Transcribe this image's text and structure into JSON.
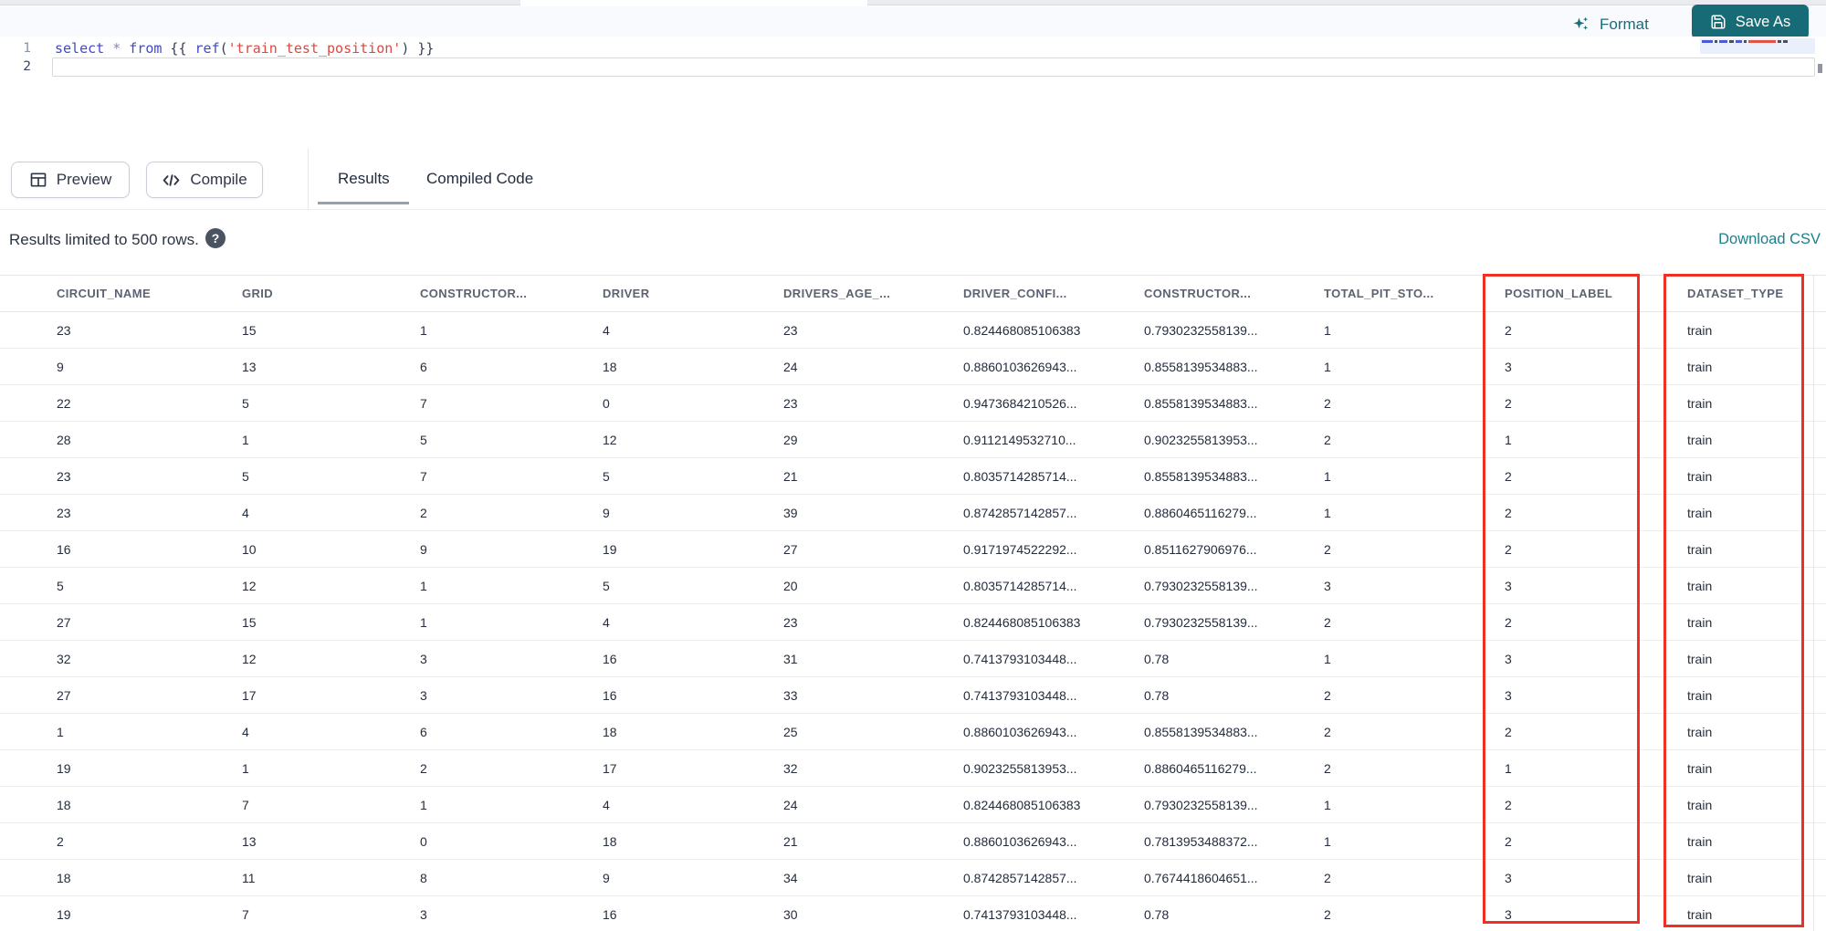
{
  "colors": {
    "accent_teal": "#176b77",
    "link_teal": "#1b7f8e",
    "highlight_red": "#ee3124",
    "keyword_blue": "#3f48c8",
    "string_red": "#de4840"
  },
  "top": {
    "format_label": "Format",
    "save_as_label": "Save As"
  },
  "editor": {
    "lines": [
      {
        "number": "1",
        "tokens": [
          {
            "t": "select",
            "c": "kw"
          },
          {
            "t": " ",
            "c": "br"
          },
          {
            "t": "*",
            "c": "op"
          },
          {
            "t": " ",
            "c": "br"
          },
          {
            "t": "from",
            "c": "kw"
          },
          {
            "t": " {{ ",
            "c": "br"
          },
          {
            "t": "ref",
            "c": "kw"
          },
          {
            "t": "(",
            "c": "br"
          },
          {
            "t": "'train_test_position'",
            "c": "str"
          },
          {
            "t": ") }}",
            "c": "br"
          }
        ]
      },
      {
        "number": "2",
        "tokens": []
      }
    ]
  },
  "toolbar": {
    "preview_label": "Preview",
    "compile_label": "Compile",
    "tabs": [
      {
        "label": "Results",
        "active": true
      },
      {
        "label": "Compiled Code",
        "active": false
      }
    ]
  },
  "results": {
    "limit_note": "Results limited to 500 rows.",
    "help_icon_glyph": "?",
    "download_label": "Download CSV"
  },
  "table": {
    "columns": [
      "CIRCUIT_NAME",
      "GRID",
      "CONSTRUCTOR...",
      "DRIVER",
      "DRIVERS_AGE_...",
      "DRIVER_CONFI...",
      "CONSTRUCTOR...",
      "TOTAL_PIT_STO...",
      "POSITION_LABEL",
      "DATASET_TYPE"
    ],
    "highlighted_columns": [
      "POSITION_LABEL",
      "DATASET_TYPE"
    ],
    "rows": [
      [
        "23",
        "15",
        "1",
        "4",
        "23",
        "0.824468085106383",
        "0.7930232558139...",
        "1",
        "2",
        "train"
      ],
      [
        "9",
        "13",
        "6",
        "18",
        "24",
        "0.8860103626943...",
        "0.8558139534883...",
        "1",
        "3",
        "train"
      ],
      [
        "22",
        "5",
        "7",
        "0",
        "23",
        "0.9473684210526...",
        "0.8558139534883...",
        "2",
        "2",
        "train"
      ],
      [
        "28",
        "1",
        "5",
        "12",
        "29",
        "0.9112149532710...",
        "0.9023255813953...",
        "2",
        "1",
        "train"
      ],
      [
        "23",
        "5",
        "7",
        "5",
        "21",
        "0.8035714285714...",
        "0.8558139534883...",
        "1",
        "2",
        "train"
      ],
      [
        "23",
        "4",
        "2",
        "9",
        "39",
        "0.8742857142857...",
        "0.8860465116279...",
        "1",
        "2",
        "train"
      ],
      [
        "16",
        "10",
        "9",
        "19",
        "27",
        "0.9171974522292...",
        "0.8511627906976...",
        "2",
        "2",
        "train"
      ],
      [
        "5",
        "12",
        "1",
        "5",
        "20",
        "0.8035714285714...",
        "0.7930232558139...",
        "3",
        "3",
        "train"
      ],
      [
        "27",
        "15",
        "1",
        "4",
        "23",
        "0.824468085106383",
        "0.7930232558139...",
        "2",
        "2",
        "train"
      ],
      [
        "32",
        "12",
        "3",
        "16",
        "31",
        "0.7413793103448...",
        "0.78",
        "1",
        "3",
        "train"
      ],
      [
        "27",
        "17",
        "3",
        "16",
        "33",
        "0.7413793103448...",
        "0.78",
        "2",
        "3",
        "train"
      ],
      [
        "1",
        "4",
        "6",
        "18",
        "25",
        "0.8860103626943...",
        "0.8558139534883...",
        "2",
        "2",
        "train"
      ],
      [
        "19",
        "1",
        "2",
        "17",
        "32",
        "0.9023255813953...",
        "0.8860465116279...",
        "2",
        "1",
        "train"
      ],
      [
        "18",
        "7",
        "1",
        "4",
        "24",
        "0.824468085106383",
        "0.7930232558139...",
        "1",
        "2",
        "train"
      ],
      [
        "2",
        "13",
        "0",
        "18",
        "21",
        "0.8860103626943...",
        "0.7813953488372...",
        "1",
        "2",
        "train"
      ],
      [
        "18",
        "11",
        "8",
        "9",
        "34",
        "0.8742857142857...",
        "0.7674418604651...",
        "2",
        "3",
        "train"
      ],
      [
        "19",
        "7",
        "3",
        "16",
        "30",
        "0.7413793103448...",
        "0.78",
        "2",
        "3",
        "train"
      ]
    ]
  }
}
